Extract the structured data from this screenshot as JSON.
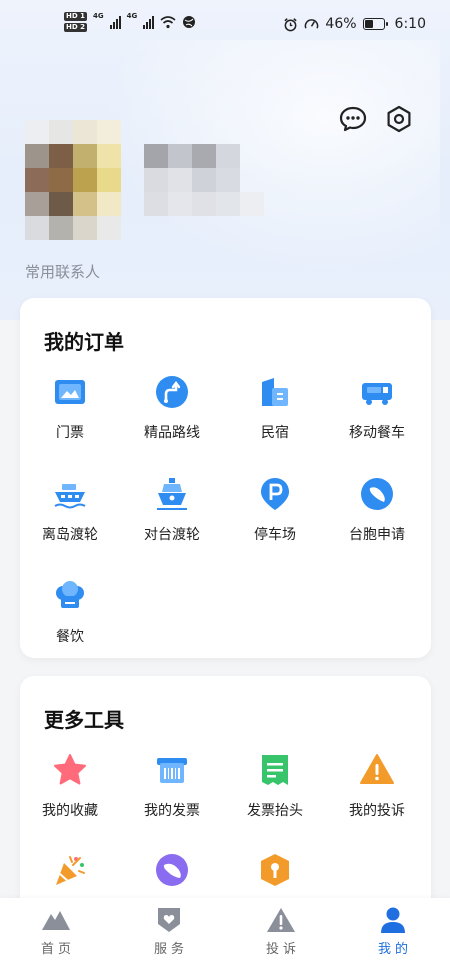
{
  "status_bar": {
    "hd1": "HD 1",
    "hd2": "HD 2",
    "net1": "4G",
    "net2": "4G",
    "battery_pct": "46%",
    "battery_level": 0.46,
    "time": "6:10"
  },
  "header": {
    "icons": [
      "chat-icon",
      "settings-icon"
    ]
  },
  "profile": {
    "contacts_label": "常用联系人"
  },
  "orders": {
    "title": "我的订单",
    "items": [
      {
        "label": "门票",
        "icon": "ticket-icon"
      },
      {
        "label": "精品路线",
        "icon": "route-icon"
      },
      {
        "label": "民宿",
        "icon": "homestay-icon"
      },
      {
        "label": "移动餐车",
        "icon": "food-truck-icon"
      },
      {
        "label": "离岛渡轮",
        "icon": "ferry-icon"
      },
      {
        "label": "对台渡轮",
        "icon": "taiwan-ferry-icon"
      },
      {
        "label": "停车场",
        "icon": "parking-icon"
      },
      {
        "label": "台胞申请",
        "icon": "taiwan-apply-icon"
      },
      {
        "label": "餐饮",
        "icon": "dining-icon"
      }
    ]
  },
  "tools": {
    "title": "更多工具",
    "items": [
      {
        "label": "我的收藏",
        "icon": "star-icon"
      },
      {
        "label": "我的发票",
        "icon": "invoice-icon"
      },
      {
        "label": "发票抬头",
        "icon": "invoice-header-icon"
      },
      {
        "label": "我的投诉",
        "icon": "complaint-icon"
      },
      {
        "label": "",
        "icon": "party-icon"
      },
      {
        "label": "",
        "icon": "planet-icon"
      },
      {
        "label": "",
        "icon": "shield-icon"
      }
    ]
  },
  "tabbar": {
    "tabs": [
      {
        "label": "首页",
        "icon": "home-icon"
      },
      {
        "label": "服务",
        "icon": "service-icon"
      },
      {
        "label": "投诉",
        "icon": "warning-icon"
      },
      {
        "label": "我的",
        "icon": "profile-icon"
      }
    ],
    "active": 3
  },
  "colors": {
    "accent": "#1f6fe0",
    "icon_blue": "#2f8cf0",
    "icon_orange": "#f39b2a",
    "icon_green": "#37c46b",
    "icon_pink": "#ff6b7a"
  }
}
